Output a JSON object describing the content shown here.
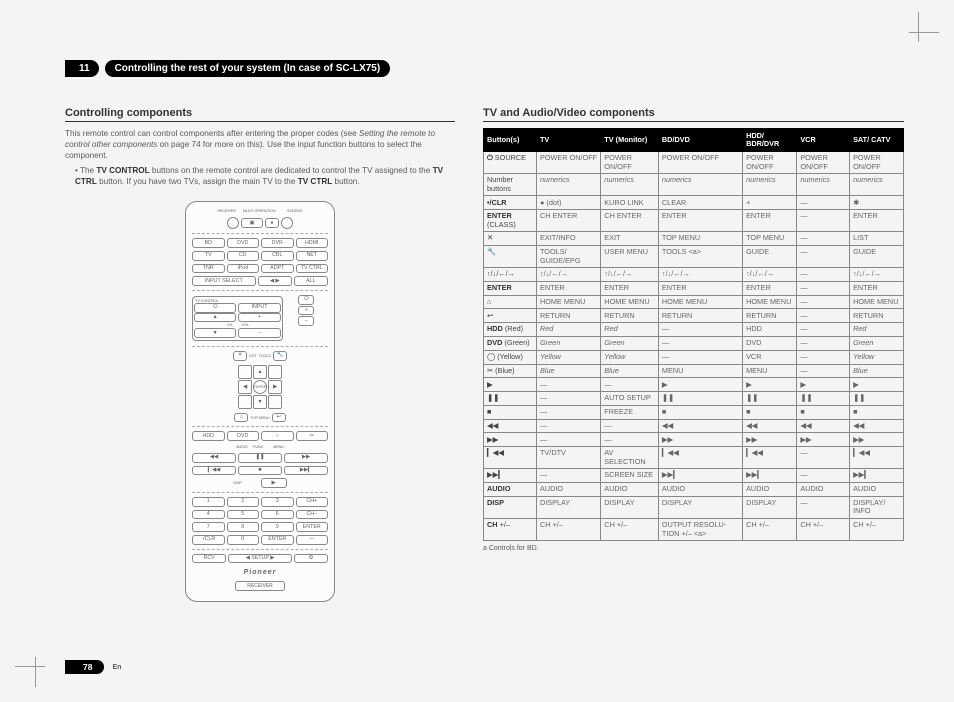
{
  "chapter": {
    "num": "11",
    "title_prefix": "Controlling the rest of your system (In case of ",
    "model": "SC-LX75",
    "title_suffix": ")"
  },
  "left": {
    "heading": "Controlling components",
    "intro_a": "This remote control can control components after entering the proper codes (see ",
    "intro_link": "Setting the remote to control other components",
    "intro_b": " on page 74 for more on this). Use the input function buttons to select the component.",
    "bullet_a": "The ",
    "bullet_bold1": "TV CONTROL",
    "bullet_b": " buttons on the remote control are dedicated to control the TV assigned to the ",
    "bullet_bold2": "TV CTRL",
    "bullet_c": " button. If you have two TVs, assign the main TV to the ",
    "bullet_bold3": "TV CTRL",
    "bullet_d": " button."
  },
  "right": {
    "heading": "TV and Audio/Video components"
  },
  "table": {
    "headers": [
      "Button(s)",
      "TV",
      "TV (Monitor)",
      "BD/DVD",
      "HDD/ BDR/DVR",
      "VCR",
      "SAT/ CATV"
    ],
    "rows": [
      {
        "h": "⏻ SOURCE",
        "hb": true,
        "c": [
          "POWER ON/OFF",
          "POWER ON/OFF",
          "POWER ON/OFF",
          "POWER ON/OFF",
          "POWER ON/OFF",
          "POWER ON/OFF"
        ]
      },
      {
        "h": "Number buttons",
        "c": [
          "numerics",
          "numerics",
          "numerics",
          "numerics",
          "numerics",
          "numerics"
        ],
        "it": true
      },
      {
        "h": "•/CLR",
        "hb": true,
        "c": [
          "● (dot)",
          "KURO LINK",
          "CLEAR",
          "+",
          "—",
          "✱"
        ]
      },
      {
        "h": "ENTER (CLASS)",
        "hb": true,
        "hnote": "(CLASS)",
        "c": [
          "CH ENTER",
          "CH ENTER",
          "ENTER",
          "ENTER",
          "—",
          "ENTER"
        ]
      },
      {
        "h": "✕",
        "sym": true,
        "c": [
          "EXIT/INFO",
          "EXIT",
          "TOP MENU",
          "TOP MENU",
          "—",
          "LIST"
        ]
      },
      {
        "h": "🔧",
        "sym": true,
        "c": [
          "TOOLS/ GUIDE/EPG",
          "USER MENU",
          "TOOLS <a>",
          "GUIDE",
          "—",
          "GUIDE"
        ]
      },
      {
        "h": "↑/↓/←/→",
        "sym": true,
        "c": [
          "↑/↓/←/→",
          "↑/↓/←/→",
          "↑/↓/←/→",
          "↑/↓/←/→",
          "—",
          "↑/↓/←/→"
        ]
      },
      {
        "h": "ENTER",
        "hb": true,
        "c": [
          "ENTER",
          "ENTER",
          "ENTER",
          "ENTER",
          "—",
          "ENTER"
        ]
      },
      {
        "h": "⌂",
        "sym": true,
        "c": [
          "HOME MENU",
          "HOME MENU",
          "HOME MENU",
          "HOME MENU",
          "—",
          "HOME MENU"
        ]
      },
      {
        "h": "↩",
        "sym": true,
        "c": [
          "RETURN",
          "RETURN",
          "RETURN",
          "RETURN",
          "—",
          "RETURN"
        ]
      },
      {
        "h": "HDD (Red)",
        "hb": true,
        "c": [
          "Red",
          "Red",
          "—",
          "HDD",
          "—",
          "Red"
        ],
        "it": true
      },
      {
        "h": "DVD (Green)",
        "hb": true,
        "c": [
          "Green",
          "Green",
          "—",
          "DVD",
          "—",
          "Green"
        ],
        "it": true
      },
      {
        "h": "◯ (Yellow)",
        "c": [
          "Yellow",
          "Yellow",
          "—",
          "VCR",
          "—",
          "Yellow"
        ],
        "it": true
      },
      {
        "h": "✂ (Blue)",
        "c": [
          "Blue",
          "Blue",
          "MENU",
          "MENU",
          "—",
          "Blue"
        ],
        "it": true
      },
      {
        "h": "▶",
        "sym": true,
        "c": [
          "—",
          "—",
          "▶",
          "▶",
          "▶",
          "▶"
        ]
      },
      {
        "h": "❚❚",
        "sym": true,
        "c": [
          "—",
          "AUTO SETUP",
          "❚❚",
          "❚❚",
          "❚❚",
          "❚❚"
        ]
      },
      {
        "h": "■",
        "sym": true,
        "c": [
          "—",
          "FREEZE",
          "■",
          "■",
          "■",
          "■"
        ]
      },
      {
        "h": "◀◀",
        "sym": true,
        "c": [
          "—",
          "—",
          "◀◀",
          "◀◀",
          "◀◀",
          "◀◀"
        ]
      },
      {
        "h": "▶▶",
        "sym": true,
        "c": [
          "—",
          "—",
          "▶▶",
          "▶▶",
          "▶▶",
          "▶▶"
        ]
      },
      {
        "h": "▎◀◀",
        "sym": true,
        "c": [
          "TV/DTV",
          "AV SELECTION",
          "▎◀◀",
          "▎◀◀",
          "—",
          "▎◀◀"
        ]
      },
      {
        "h": "▶▶▎",
        "sym": true,
        "c": [
          "—",
          "SCREEN SIZE",
          "▶▶▎",
          "▶▶▎",
          "—",
          "▶▶▎"
        ]
      },
      {
        "h": "AUDIO",
        "hb": true,
        "c": [
          "AUDIO",
          "AUDIO",
          "AUDIO",
          "AUDIO",
          "AUDIO",
          "AUDIO"
        ]
      },
      {
        "h": "DISP",
        "hb": true,
        "c": [
          "DISPLAY",
          "DISPLAY",
          "DISPLAY",
          "DISPLAY",
          "—",
          "DISPLAY/ INFO"
        ]
      },
      {
        "h": "CH +/–",
        "hb": true,
        "c": [
          "CH +/–",
          "CH +/–",
          "OUTPUT RESOLU-TION +/– <a>",
          "CH +/–",
          "CH +/–",
          "CH +/–"
        ]
      }
    ],
    "footnote": "a   Controls for BD."
  },
  "remote": {
    "top_labels": [
      "RECEIVER",
      "MULTI OPERATION",
      "SOURCE"
    ],
    "row2": [
      "BD",
      "DVD",
      "DVR",
      "HDMI"
    ],
    "row3": [
      "TV",
      "CD",
      "CBL",
      "NET"
    ],
    "row4": [
      "TNR",
      "iPod",
      "ADPT",
      "TV CTRL"
    ],
    "row5_left": "INPUT SELECT",
    "row5_right": "ALL",
    "tvc_label": "TV CONTROL",
    "tvc": [
      "⏻",
      "INPUT",
      "CH",
      "VOL"
    ],
    "right_col": [
      "⏻",
      "+",
      "–"
    ],
    "side": [
      "✕",
      "LIST",
      "TOOLS",
      "⌂",
      "↩",
      "TOP MENU"
    ],
    "color_row": [
      "HDD",
      "DVD",
      "○",
      "✂"
    ],
    "media": [
      "AUDIO",
      "FUNC",
      "MENU",
      "◀◀",
      "❚❚",
      "▶▶",
      "▎◀◀",
      "■",
      "▶▶▎",
      "DISP",
      "▶"
    ],
    "nums": [
      "1",
      "2",
      "3",
      "CH+",
      "4",
      "5",
      "6",
      "CH–",
      "7",
      "8",
      "9",
      "ENTER",
      "·/CLR",
      "0",
      "ENTER",
      "—"
    ],
    "bottom": [
      "RCV",
      "SETUP",
      "⚙"
    ],
    "logo": "Pioneer",
    "sub": "RECEIVER"
  },
  "footer": {
    "page": "78",
    "lang": "En"
  }
}
